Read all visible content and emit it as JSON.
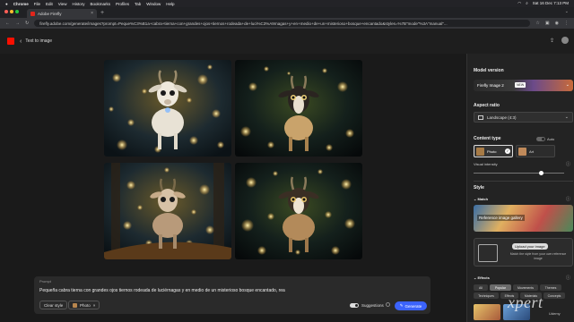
{
  "menubar": {
    "app": "Chrome",
    "items": [
      "File",
      "Edit",
      "View",
      "History",
      "Bookmarks",
      "Profiles",
      "Tab",
      "Window",
      "Help"
    ],
    "clock": "Sat 16 Dec  7:13 PM"
  },
  "tab": {
    "title": "Adobe Firefly",
    "close": "×",
    "new_tab": "+"
  },
  "address": {
    "url": "firefly.adobe.com/generate/images?prompt=Peque%C3%B1a+cabra+tierna+con+grandes+ojos+tiernos+rodeada+de+luci%C3%A9rnagas+y+en+medio+de+un+misterioso+bosque+encantado&styles=%7B\"mode\"%3A\"manual\"..."
  },
  "header": {
    "back": "‹",
    "title": "Text to image"
  },
  "prompt": {
    "label": "Prompt",
    "text": "Pequeña cabra tierna con grandes ojos tiernos rodeada de luciérnagas y en medio de un misterioso bosque encantado, rea",
    "clear_style": "Clear style",
    "photo_chip": "Photo",
    "photo_chip_close": "×",
    "suggestions": "Suggestions",
    "generate": "Generate"
  },
  "panel": {
    "model_version": "Model version",
    "model_name": "Firefly Image 2",
    "model_badge": "NEW",
    "aspect_ratio": "Aspect ratio",
    "aspect_value": "Landscape (4:3)",
    "content_type": "Content type",
    "auto": "Auto",
    "photo": "Photo",
    "art": "Art",
    "visual_intensity": "Visual intensity",
    "style": "Style",
    "match": "Match",
    "reference_gallery": "Reference image gallery",
    "upload_image": "Upload your image",
    "upload_hint": "Match the style from your own reference image",
    "effects": "Effects",
    "effect_tabs": [
      "All",
      "Popular",
      "Movements",
      "Themes",
      "Techniques",
      "Effects",
      "Materials",
      "Concepts"
    ],
    "visual_intensity_level": 0.75
  },
  "watermark": {
    "brand": "xpert",
    "sub": "Udemy"
  },
  "colors": {
    "accent": "#3b63fb",
    "adobe_red": "#fa0f00",
    "bg": "#1a1a1a"
  }
}
